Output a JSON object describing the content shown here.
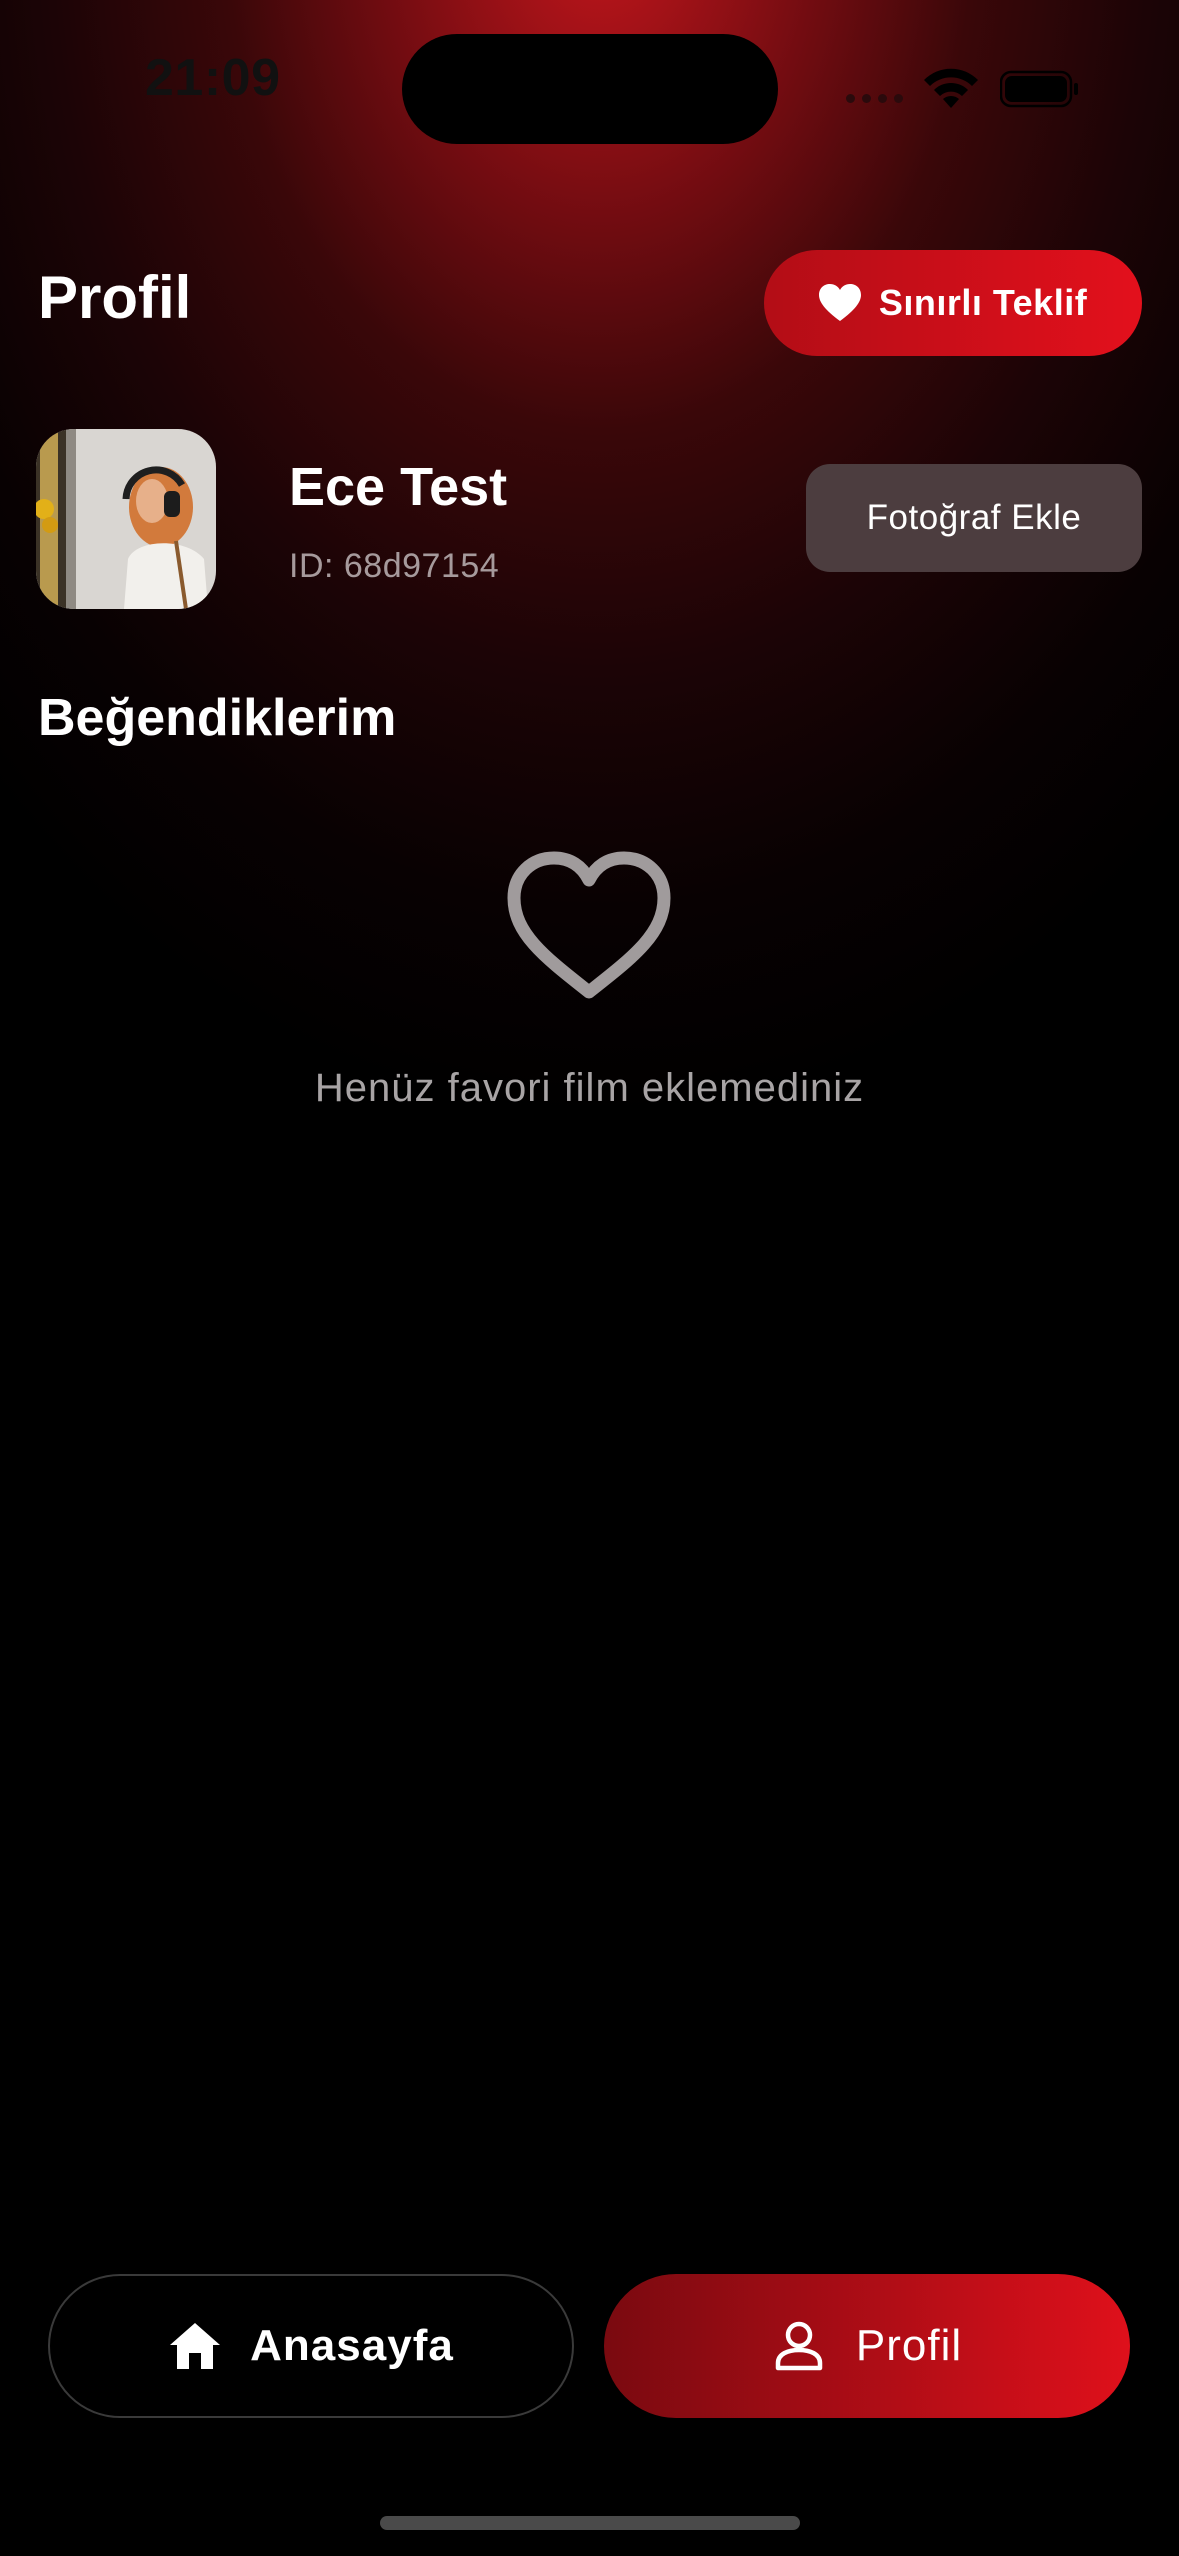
{
  "status_bar": {
    "time": "21:09",
    "icons": [
      "cellular-signal-icon",
      "wifi-icon",
      "battery-icon"
    ]
  },
  "header": {
    "title": "Profil",
    "offer_button": {
      "label": "Sınırlı Teklif",
      "icon": "heart-icon"
    }
  },
  "profile": {
    "name": "Ece Test",
    "id_text": "ID: 68d97154",
    "add_photo_label": "Fotoğraf Ekle"
  },
  "favorites": {
    "title": "Beğendiklerim",
    "empty_icon": "heart-outline-icon",
    "empty_message": "Henüz favori film eklemediniz"
  },
  "bottom_nav": {
    "items": [
      {
        "label": "Anasayfa",
        "icon": "home-icon",
        "active": false
      },
      {
        "label": "Profil",
        "icon": "user-icon",
        "active": true
      }
    ]
  },
  "colors": {
    "accent": "#e3101c",
    "accent_dark": "#7a0a10",
    "secondary_button": "#4c3d3f",
    "muted_text": "#a8a4a5"
  }
}
